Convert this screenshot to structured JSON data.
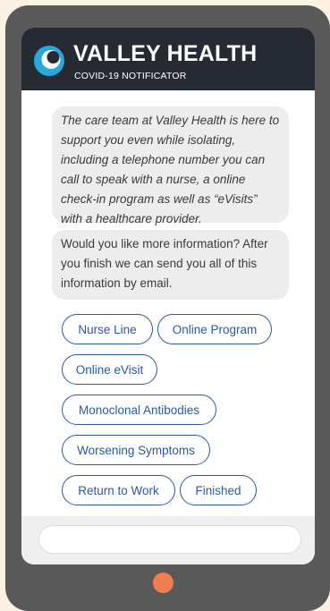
{
  "header": {
    "title": "VALLEY HEALTH",
    "subtitle": "COVID-19 NOTIFICATOR"
  },
  "messages": [
    {
      "text": "The care team at Valley Health is here to support you even while isolating, including a telephone number you can call to speak with a nurse, a online check-in program as well as “eVisits” with a healthcare provider."
    },
    {
      "text": "Would you like more information? After you finish we can send you all of this information by email."
    }
  ],
  "options": [
    {
      "label": "Nurse Line"
    },
    {
      "label": "Online Program"
    },
    {
      "label": "Online eVisit"
    },
    {
      "label": "Monoclonal Antibodies"
    },
    {
      "label": "Worsening Symptoms"
    },
    {
      "label": "Return to Work"
    },
    {
      "label": "Finished"
    }
  ],
  "composer": {
    "value": "",
    "placeholder": ""
  },
  "colors": {
    "header_bg": "#252a33",
    "accent": "#2c5a9e",
    "logo_blue": "#29a8e0",
    "home_button": "#f07e4f",
    "device_frame": "#595959"
  },
  "icons": {
    "logo": "valley-health-logo-icon"
  }
}
